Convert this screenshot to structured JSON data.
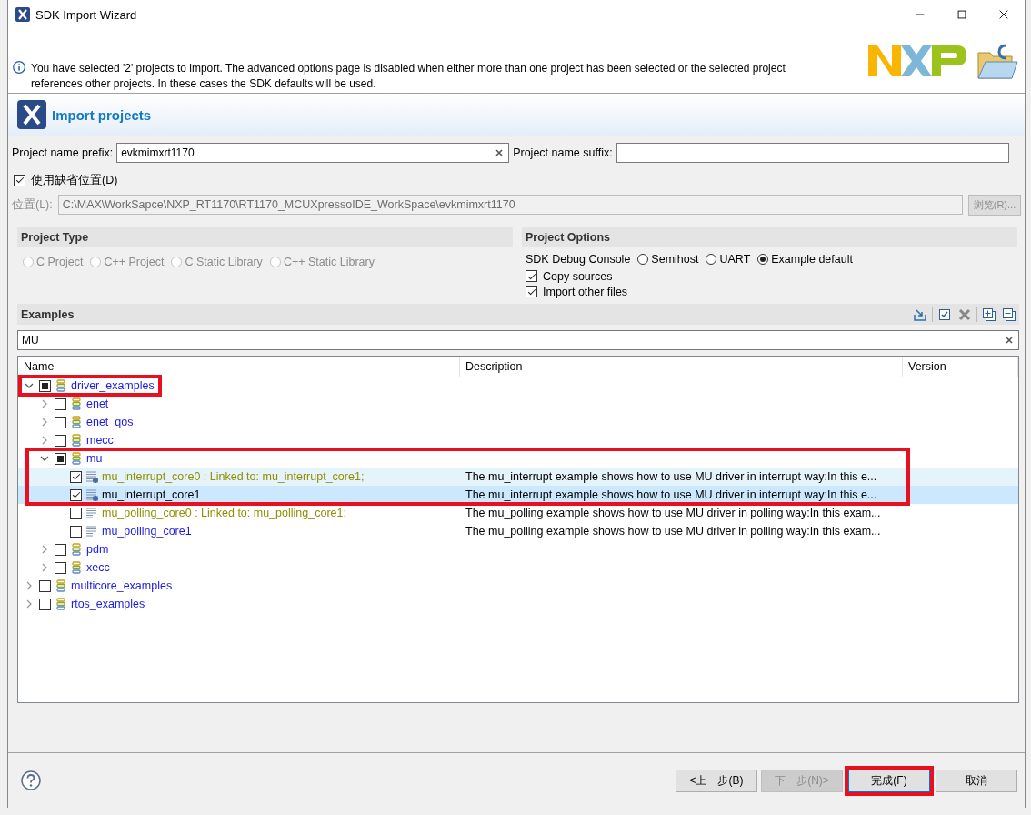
{
  "window": {
    "title": "SDK Import Wizard"
  },
  "info": {
    "text": "You have selected '2' projects to import. The advanced options page is disabled when either more than one project has been selected or the selected project references other projects. In these cases the SDK defaults will be used."
  },
  "banner": {
    "title": "Import projects"
  },
  "prefix": {
    "label": "Project name prefix:",
    "value": "evkmimxrt1170"
  },
  "suffix": {
    "label": "Project name suffix:"
  },
  "default_location": {
    "label": "使用缺省位置(D)",
    "checked": true
  },
  "location": {
    "label": "位置(L):",
    "value": "C:\\MAX\\WorkSapce\\NXP_RT1170\\RT1170_MCUXpressoIDE_WorkSpace\\evkmimxrt1170",
    "disabled": true,
    "browse": "浏览(R)..."
  },
  "project_type": {
    "title": "Project Type",
    "options": [
      {
        "label": "C Project",
        "selected": false,
        "disabled": true
      },
      {
        "label": "C++ Project",
        "selected": false,
        "disabled": true
      },
      {
        "label": "C Static Library",
        "selected": false,
        "disabled": true
      },
      {
        "label": "C++ Static Library",
        "selected": false,
        "disabled": true
      }
    ]
  },
  "project_options": {
    "title": "Project Options",
    "console_label": "SDK Debug Console",
    "console_options": [
      {
        "label": "Semihost",
        "selected": false
      },
      {
        "label": "UART",
        "selected": false
      },
      {
        "label": "Example default",
        "selected": true
      }
    ],
    "checkboxes": [
      {
        "label": "Copy sources",
        "checked": true
      },
      {
        "label": "Import other files",
        "checked": true
      }
    ]
  },
  "examples": {
    "title": "Examples",
    "filter": "MU",
    "columns": [
      "Name",
      "Description",
      "Version"
    ],
    "tree": [
      {
        "kind": "group",
        "name": "driver_examples",
        "checked": false,
        "partial": true,
        "expanded": true,
        "highlighted": true,
        "children": [
          {
            "kind": "group",
            "name": "enet",
            "checked": false,
            "partial": false,
            "expanded": false,
            "highlighted": false
          },
          {
            "kind": "group",
            "name": "enet_qos",
            "checked": false,
            "partial": false,
            "expanded": false,
            "highlighted": false
          },
          {
            "kind": "group",
            "name": "mecc",
            "checked": false,
            "partial": false,
            "expanded": false,
            "highlighted": false
          },
          {
            "kind": "group",
            "name": "mu",
            "checked": false,
            "partial": true,
            "expanded": true,
            "highlighted": true,
            "children": [
              {
                "kind": "example",
                "name": "mu_interrupt_core0 : Linked to: mu_interrupt_core1;",
                "description": "The mu_interrupt example shows how to use MU driver in interrupt way:In this e...",
                "checked": true,
                "linked": true,
                "selected": false,
                "hovered": true,
                "highlighted": true
              },
              {
                "kind": "example",
                "name": "mu_interrupt_core1",
                "description": "The mu_interrupt example shows how to use MU driver in interrupt way:In this e...",
                "checked": true,
                "linked": false,
                "selected": true,
                "hovered": false,
                "highlighted": true
              },
              {
                "kind": "example",
                "name": "mu_polling_core0 : Linked to: mu_polling_core1;",
                "description": "The mu_polling example shows how to use MU driver in polling way:In this exam...",
                "checked": false,
                "linked": true,
                "selected": false,
                "hovered": false,
                "highlighted": false
              },
              {
                "kind": "example",
                "name": "mu_polling_core1",
                "description": "The mu_polling example shows how to use MU driver in polling way:In this exam...",
                "checked": false,
                "linked": false,
                "selected": false,
                "hovered": false,
                "highlighted": false
              }
            ]
          },
          {
            "kind": "group",
            "name": "pdm",
            "checked": false,
            "partial": false,
            "expanded": false,
            "highlighted": false
          },
          {
            "kind": "group",
            "name": "xecc",
            "checked": false,
            "partial": false,
            "expanded": false,
            "highlighted": false
          }
        ]
      },
      {
        "kind": "group",
        "name": "multicore_examples",
        "checked": false,
        "partial": false,
        "expanded": false,
        "highlighted": false
      },
      {
        "kind": "group",
        "name": "rtos_examples",
        "checked": false,
        "partial": false,
        "expanded": false,
        "highlighted": false
      }
    ]
  },
  "buttons": [
    {
      "label": "<上一步(B)",
      "disabled": false,
      "highlighted": false
    },
    {
      "label": "下一步(N)>",
      "disabled": true,
      "highlighted": false
    },
    {
      "label": "完成(F)",
      "disabled": false,
      "highlighted": true
    },
    {
      "label": "取消",
      "disabled": false,
      "highlighted": false
    }
  ]
}
